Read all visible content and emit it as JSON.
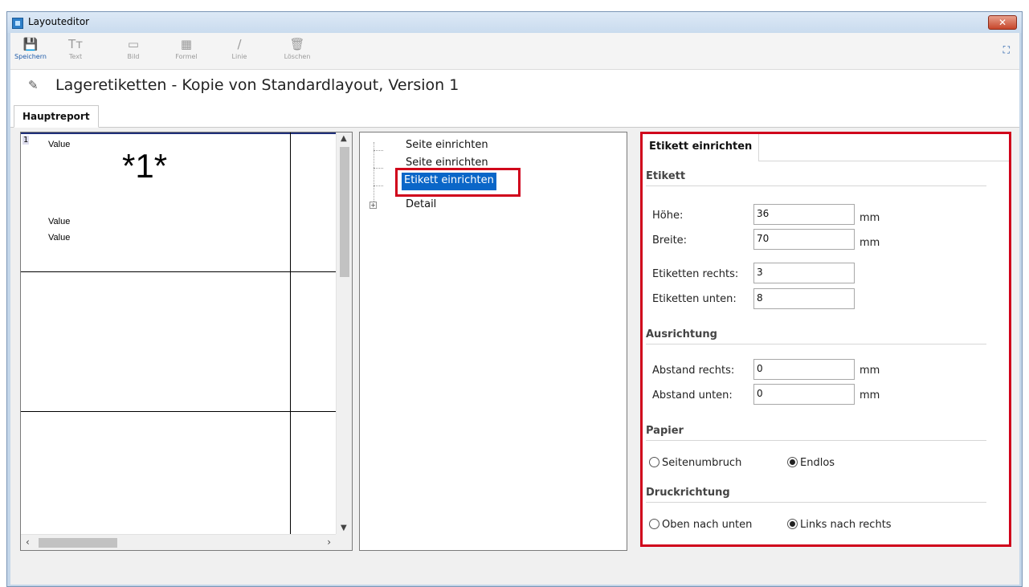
{
  "window": {
    "title": "Layouteditor",
    "close_label": "✕"
  },
  "toolbar": {
    "items": [
      {
        "label": "Speichern",
        "icon": "save-icon",
        "glyph": "💾"
      },
      {
        "label": "Text",
        "icon": "text-icon",
        "glyph": "Tт"
      },
      {
        "label": "Bild",
        "icon": "image-icon",
        "glyph": "▭"
      },
      {
        "label": "Formel",
        "icon": "formula-icon",
        "glyph": "▦"
      },
      {
        "label": "Linie",
        "icon": "line-icon",
        "glyph": "/"
      },
      {
        "label": "Löschen",
        "icon": "delete-icon",
        "glyph": "🗑"
      }
    ],
    "fullscreen_glyph": "⛶"
  },
  "document": {
    "title": "Lageretiketten - Kopie von Standardlayout, Version 1"
  },
  "tabs": {
    "main": "Hauptreport"
  },
  "preview": {
    "index": "1",
    "field_1": "Value",
    "big_text": "*1*",
    "field_2": "Value",
    "field_3": "Value"
  },
  "tree": {
    "items": [
      {
        "label": "Seite einrichten"
      },
      {
        "label": "Seite einrichten"
      },
      {
        "label": "Etikett einrichten",
        "selected": true
      },
      {
        "label": "Detail"
      }
    ]
  },
  "settings": {
    "tab": "Etikett einrichten",
    "etikett": {
      "heading": "Etikett",
      "hoehe_label": "Höhe:",
      "hoehe_value": "36",
      "hoehe_unit": "mm",
      "breite_label": "Breite:",
      "breite_value": "70",
      "breite_unit": "mm",
      "rechts_label": "Etiketten rechts:",
      "rechts_value": "3",
      "unten_label": "Etiketten unten:",
      "unten_value": "8"
    },
    "ausrichtung": {
      "heading": "Ausrichtung",
      "rechts_label": "Abstand rechts:",
      "rechts_value": "0",
      "rechts_unit": "mm",
      "unten_label": "Abstand unten:",
      "unten_value": "0",
      "unten_unit": "mm"
    },
    "papier": {
      "heading": "Papier",
      "option_1": "Seitenumbruch",
      "option_2": "Endlos",
      "selected": "Endlos"
    },
    "druckrichtung": {
      "heading": "Druckrichtung",
      "option_1": "Oben nach unten",
      "option_2": "Links nach rechts",
      "selected": "Links nach rechts"
    }
  },
  "colors": {
    "accent": "#0a66c8",
    "highlight": "#d0021b"
  }
}
